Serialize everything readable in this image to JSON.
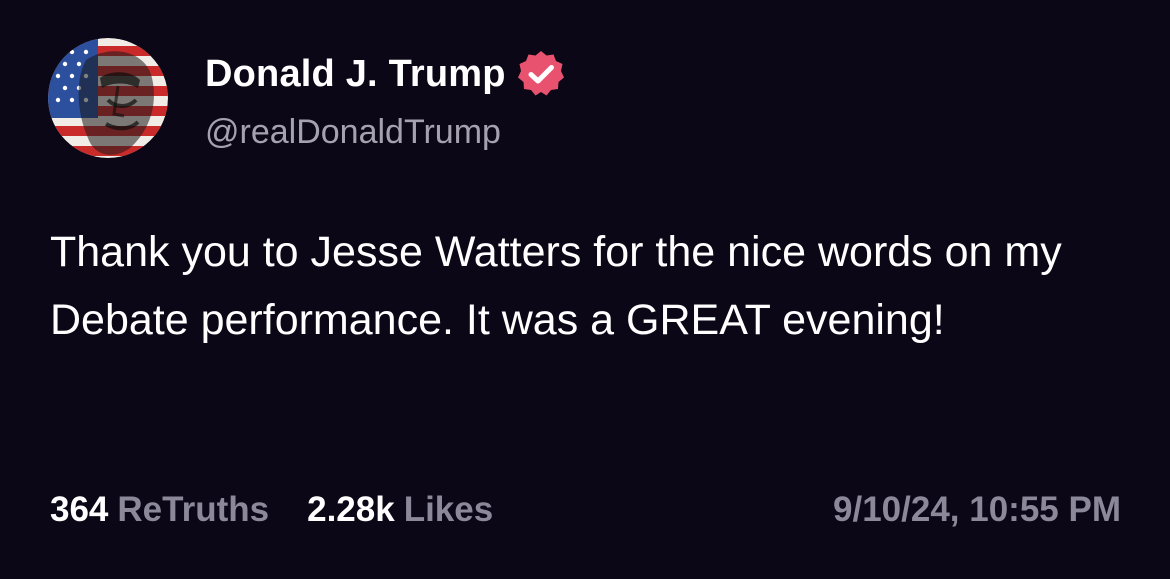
{
  "colors": {
    "background": "#0b0716",
    "text_primary": "#ffffff",
    "text_secondary": "#8b8899",
    "verified_badge": "#e8526e"
  },
  "author": {
    "display_name": "Donald J. Trump",
    "handle": "@realDonaldTrump",
    "avatar_icon": "american-flag-portrait-avatar",
    "verified_icon": "verified-badge-icon"
  },
  "post": {
    "text": "Thank you to Jesse Watters for the nice words on my Debate performance. It was a GREAT evening!"
  },
  "stats": {
    "retruths_count": "364",
    "retruths_label": "ReTruths",
    "likes_count": "2.28k",
    "likes_label": "Likes"
  },
  "timestamp": "9/10/24, 10:55 PM"
}
